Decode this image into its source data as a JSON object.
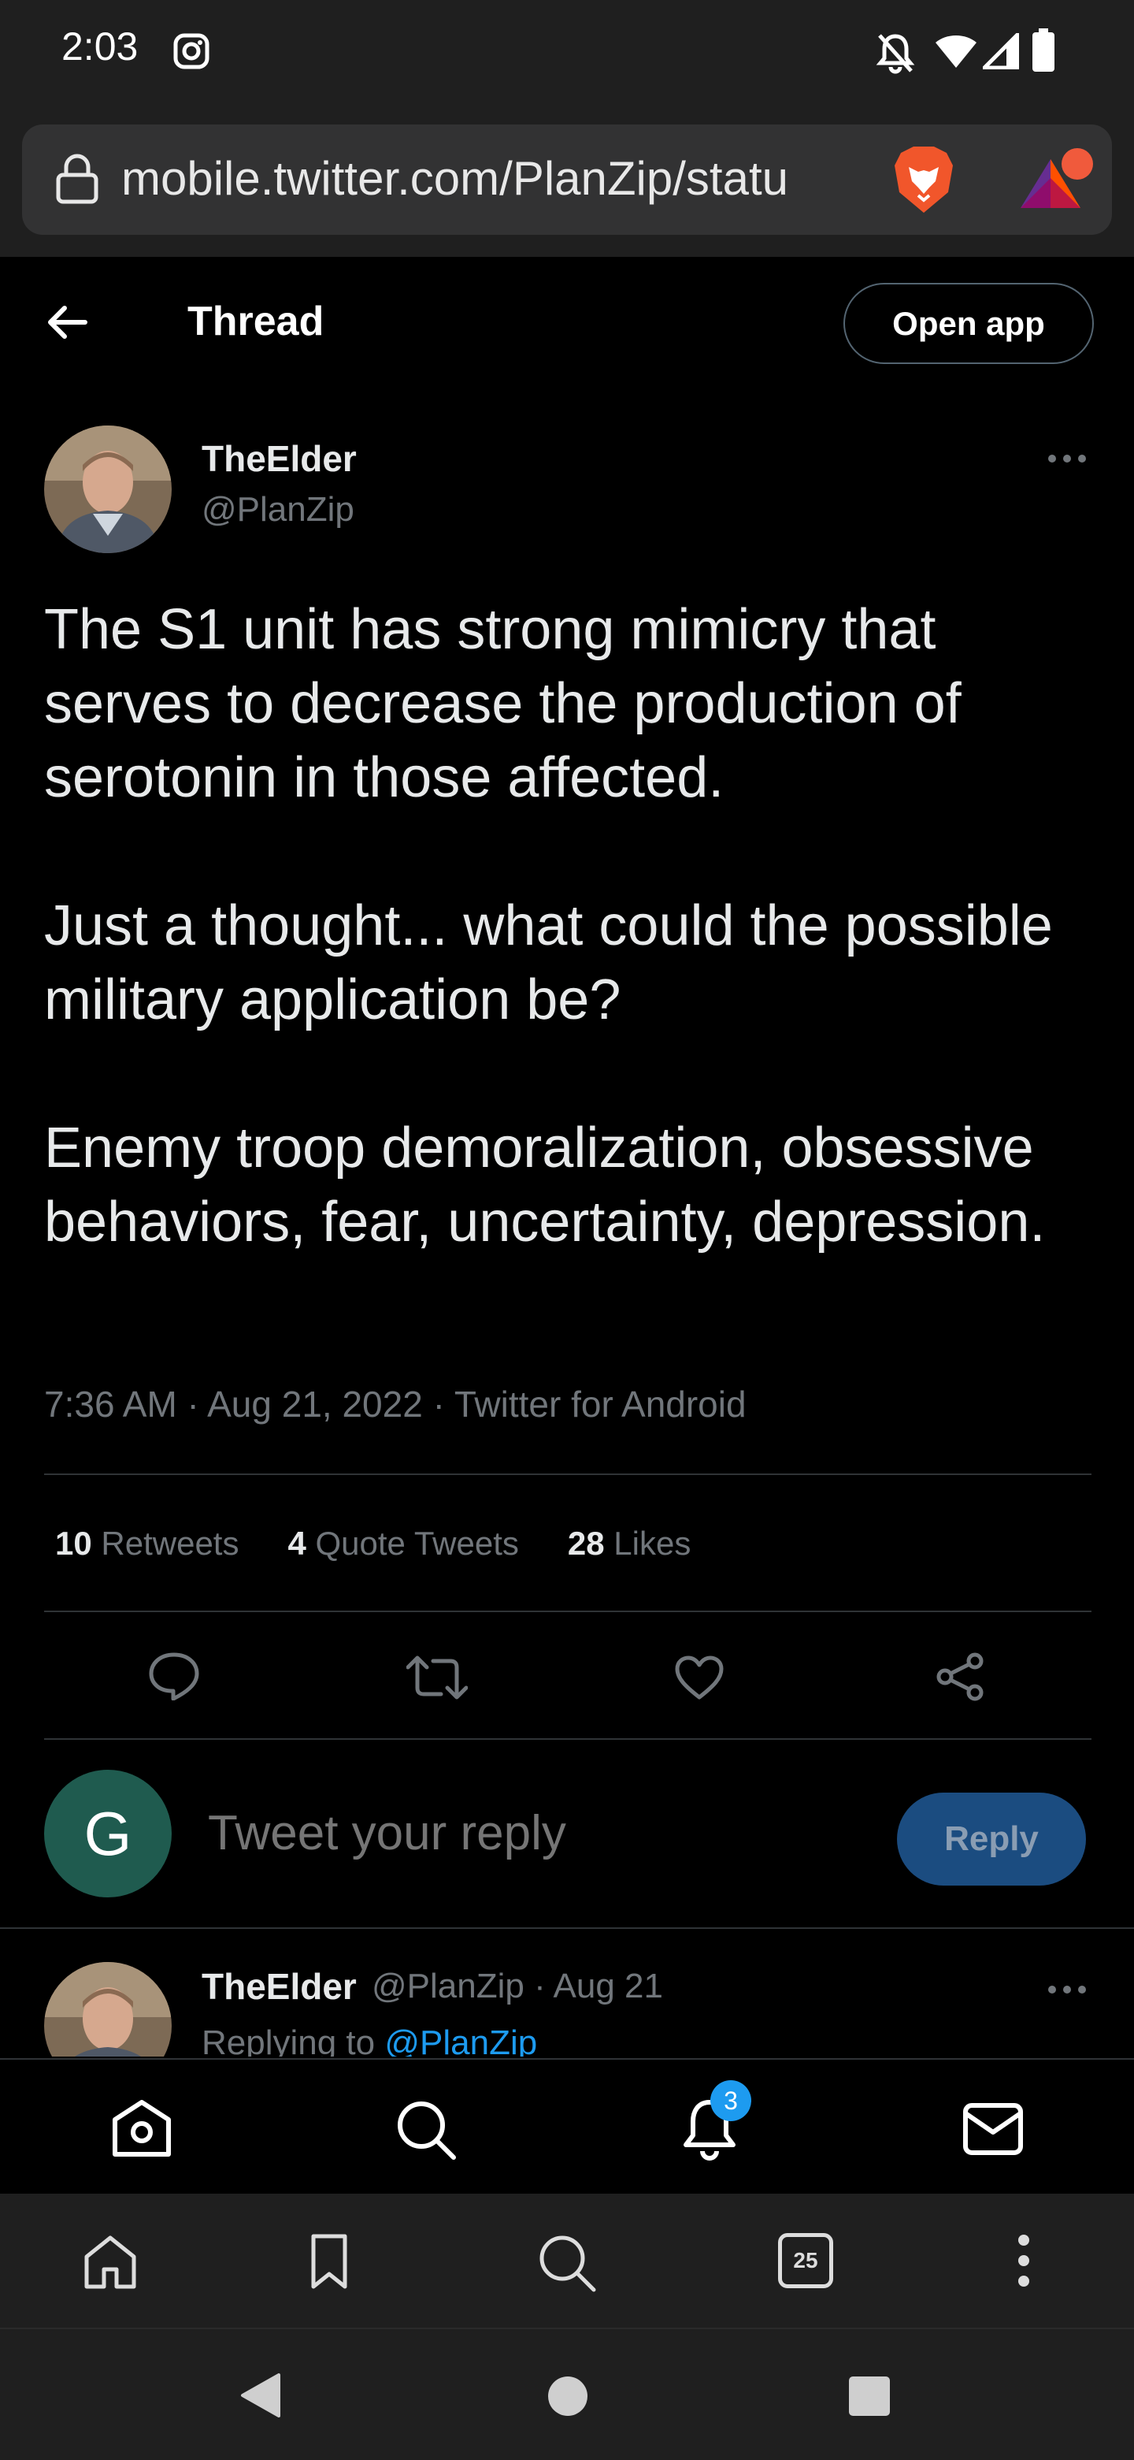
{
  "status_bar": {
    "time": "2:03",
    "icons": [
      "instagram-icon",
      "bell-muted-icon",
      "wifi-icon",
      "signal-icon",
      "battery-icon"
    ]
  },
  "browser": {
    "url": "mobile.twitter.com/PlanZip/statu",
    "icons": [
      "lock-icon",
      "brave-lion-icon",
      "brave-rewards-icon"
    ]
  },
  "header": {
    "title": "Thread",
    "open_app_label": "Open app"
  },
  "tweet": {
    "author_name": "TheElder",
    "author_handle": "@PlanZip",
    "text": "The S1 unit has strong mimicry that serves to decrease the production of serotonin in those affected.\n\nJust a thought... what could the possible military application be?\n\nEnemy troop demoralization, obsessive behaviors, fear, uncertainty, depression.",
    "meta": "7:36 AM · Aug 21, 2022 · Twitter for Android",
    "retweets_count": "10",
    "retweets_label": "Retweets",
    "quotes_count": "4",
    "quotes_label": "Quote Tweets",
    "likes_count": "28",
    "likes_label": "Likes"
  },
  "reply_box": {
    "avatar_letter": "G",
    "placeholder": "Tweet your reply",
    "button_label": "Reply"
  },
  "second_tweet": {
    "author_name": "TheElder",
    "handle_and_date": "@PlanZip · Aug 21",
    "replying_prefix": "Replying to",
    "replying_mention": "@PlanZip"
  },
  "twitter_nav": {
    "notifications_badge": "3",
    "items": [
      "home-icon",
      "search-icon",
      "notifications-icon",
      "messages-icon"
    ]
  },
  "browser_toolbar": {
    "tab_count": "25",
    "items": [
      "home-icon",
      "bookmark-icon",
      "search-icon",
      "tabs-icon",
      "menu-icon"
    ]
  },
  "colors": {
    "background": "#000000",
    "accent": "#1d9bf0",
    "muted_text": "#71767b",
    "reply_avatar": "#1f5b4f"
  }
}
